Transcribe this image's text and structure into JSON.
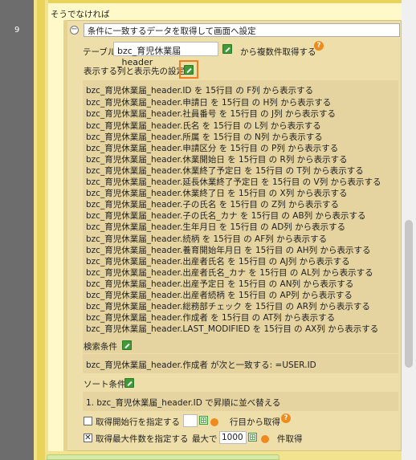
{
  "gutter": {
    "line_number": "9"
  },
  "else_label": "そうでなければ",
  "block": {
    "title": "条件に一致するデータを取得して画面へ設定",
    "table_label": "テーブル",
    "table_value": "bzc_育児休業届_header",
    "after_table_label": "から複数件取得する",
    "columns_label": "表示する列と表示先の設定",
    "columns": [
      "bzc_育児休業届_header.ID を 15行目 の F列 から表示する",
      "bzc_育児休業届_header.申請日 を 15行目 の H列 から表示する",
      "bzc_育児休業届_header.社員番号 を 15行目 の J列 から表示する",
      "bzc_育児休業届_header.氏名 を 15行目 の L列 から表示する",
      "bzc_育児休業届_header.所属 を 15行目 の N列 から表示する",
      "bzc_育児休業届_header.申請区分 を 15行目 の P列 から表示する",
      "bzc_育児休業届_header.休業開始日 を 15行目 の R列 から表示する",
      "bzc_育児休業届_header.休業終了予定日 を 15行目 の T列 から表示する",
      "bzc_育児休業届_header.延長休業終了予定日 を 15行目 の V列 から表示する",
      "bzc_育児休業届_header.休業終了日 を 15行目 の X列 から表示する",
      "bzc_育児休業届_header.子の氏名 を 15行目 の Z列 から表示する",
      "bzc_育児休業届_header.子の氏名_カナ を 15行目 の AB列 から表示する",
      "bzc_育児休業届_header.生年月日 を 15行目 の AD列 から表示する",
      "bzc_育児休業届_header.続柄 を 15行目 の AF列 から表示する",
      "bzc_育児休業届_header.養育開始年月日 を 15行目 の AH列 から表示する",
      "bzc_育児休業届_header.出産者氏名 を 15行目 の AJ列 から表示する",
      "bzc_育児休業届_header.出産者氏名_カナ を 15行目 の AL列 から表示する",
      "bzc_育児休業届_header.出産予定日 を 15行目 の AN列 から表示する",
      "bzc_育児休業届_header.出産者続柄 を 15行目 の AP列 から表示する",
      "bzc_育児休業届_header.総務部チェック を 15行目 の AR列 から表示する",
      "bzc_育児休業届_header.作成者 を 15行目 の AT列 から表示する",
      "bzc_育児休業届_header.LAST_MODIFIED を 15行目 の AX列 から表示する"
    ],
    "search_label": "検索条件",
    "search_condition": "bzc_育児休業届_header.作成者 が次と一致する: =USER.ID",
    "sort_label": "ソート条件",
    "sort_condition": "1. bzc_育児休業届_header.ID で昇順に並べ替える",
    "start_row_label": "取得開始行を指定する",
    "start_row_value": "",
    "start_row_suffix": "行目から取得",
    "max_rows_label": "取得最大件数を指定する",
    "max_prefix": "最大で",
    "max_rows_value": "1000",
    "max_suffix": "件取得"
  }
}
